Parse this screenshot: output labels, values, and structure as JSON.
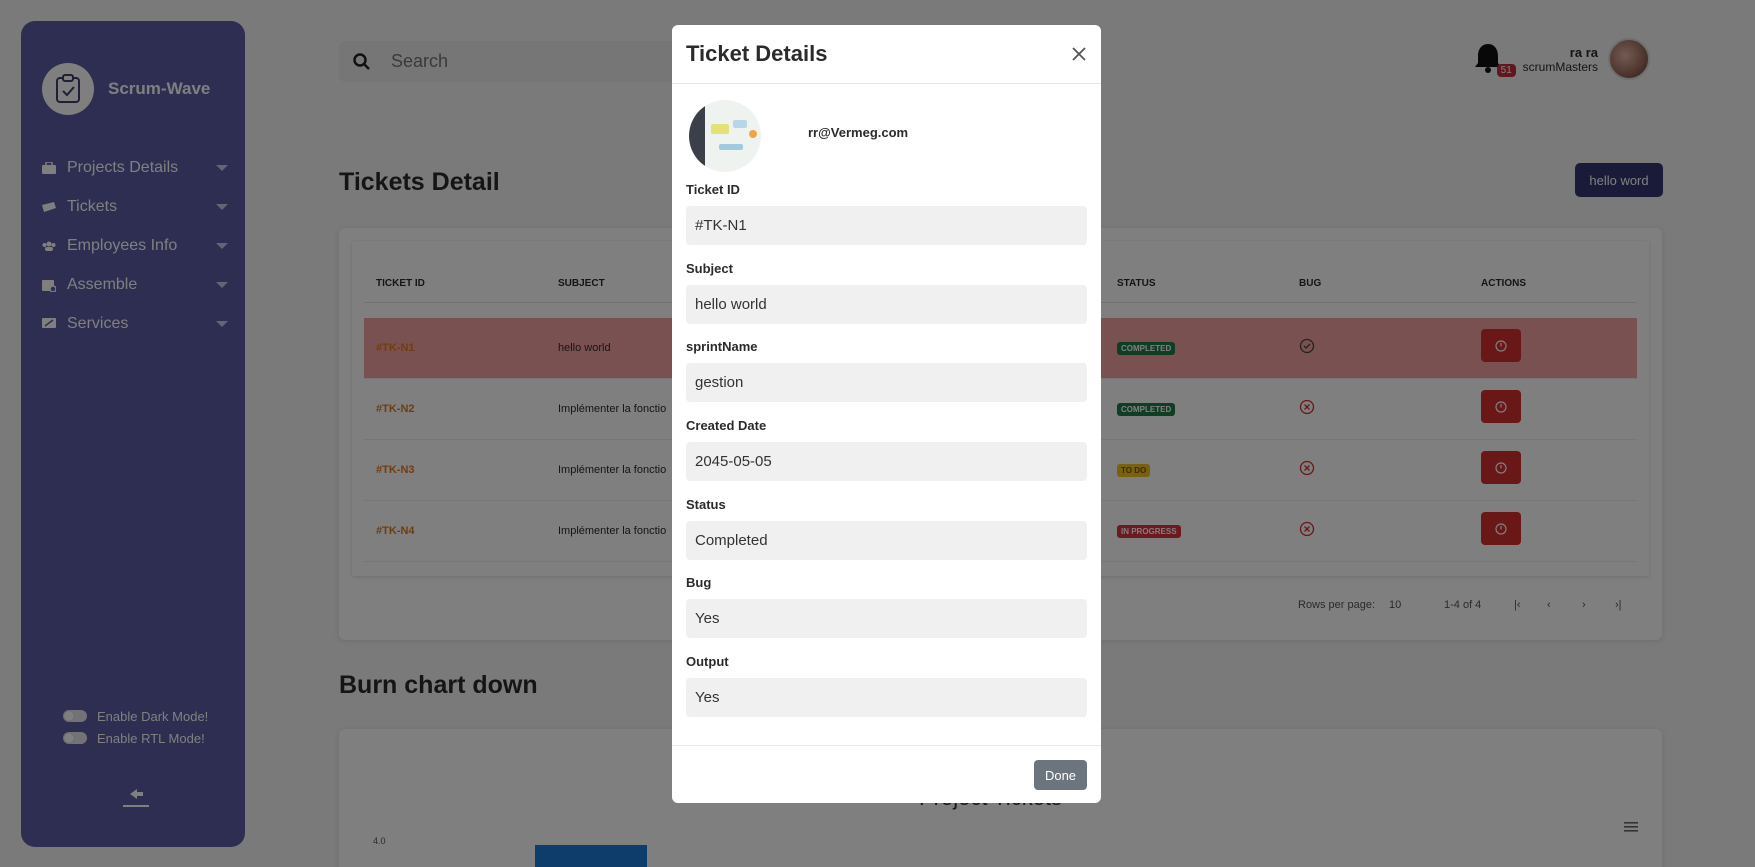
{
  "sidebar": {
    "brand": "Scrum-Wave",
    "items": [
      {
        "label": "Projects Details",
        "icon": "briefcase-icon"
      },
      {
        "label": "Tickets",
        "icon": "ticket-icon"
      },
      {
        "label": "Employees Info",
        "icon": "users-icon"
      },
      {
        "label": "Assemble",
        "icon": "calendar-icon"
      },
      {
        "label": "Services",
        "icon": "monitor-icon"
      }
    ],
    "dark_mode_label": "Enable Dark Mode!",
    "rtl_mode_label": "Enable RTL Mode!"
  },
  "header": {
    "search_placeholder": "Search",
    "notification_count": "51",
    "user_name": "ra ra",
    "user_role": "scrumMasters"
  },
  "page": {
    "title": "Tickets Detail",
    "action_button": "hello word"
  },
  "table": {
    "columns": [
      "TICKET ID",
      "SUBJECT",
      "STATUS",
      "BUG",
      "ACTIONS"
    ],
    "rows": [
      {
        "id": "#TK-N1",
        "subject": "hello world",
        "status": "COMPLETED",
        "bug": "check"
      },
      {
        "id": "#TK-N2",
        "subject": "Implémenter la fonctio",
        "status": "COMPLETED",
        "bug": "x"
      },
      {
        "id": "#TK-N3",
        "subject": "Implémenter la fonctio",
        "status": "TO DO",
        "bug": "x"
      },
      {
        "id": "#TK-N4",
        "subject": "Implémenter la fonctio",
        "status": "IN PROGRESS",
        "bug": "x"
      }
    ],
    "rows_per_page_label": "Rows per page:",
    "rows_per_page_value": "10",
    "range_text": "1-4 of 4"
  },
  "chart_section": {
    "title": "Burn chart down",
    "chart_title": "Project Tickets",
    "top_tick": "4.0"
  },
  "chart_data": {
    "type": "bar",
    "title": "Project Tickets",
    "ylim": [
      0,
      4.0
    ]
  },
  "modal": {
    "title": "Ticket Details",
    "email": "rr@Vermeg.com",
    "fields": [
      {
        "label": "Ticket ID",
        "value": "#TK-N1"
      },
      {
        "label": "Subject",
        "value": "hello world"
      },
      {
        "label": "sprintName",
        "value": "gestion"
      },
      {
        "label": "Created Date",
        "value": "2045-05-05"
      },
      {
        "label": "Status",
        "value": "Completed"
      },
      {
        "label": "Bug",
        "value": "Yes"
      },
      {
        "label": "Output",
        "value": "Yes"
      }
    ],
    "done_label": "Done"
  },
  "colors": {
    "sidebar": "#5a5da3",
    "highlight_row": "#f5a3a3",
    "action_red": "#d32f2f",
    "ticket_orange": "#e07a1f",
    "primary_dark": "#343770"
  }
}
